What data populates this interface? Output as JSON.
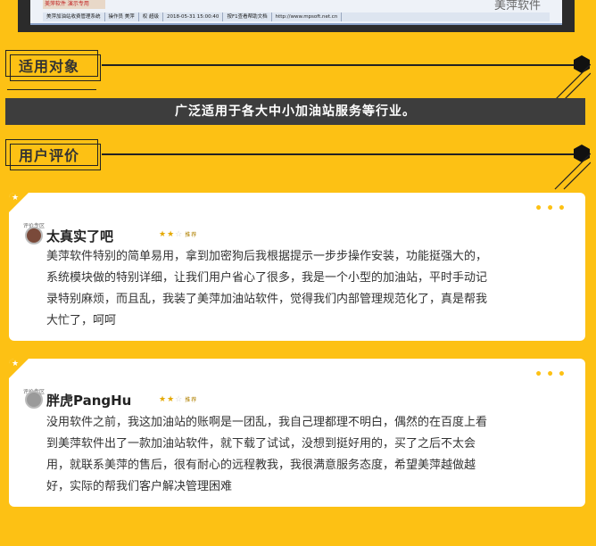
{
  "top_screenshot": {
    "banner_text": "美萍软件 演示专用",
    "status_items": [
      "美萍加油站收费管理系统",
      "操作员 美萍",
      "权 超级",
      "2018-05-31 15:00:40",
      "按F1查看帮助文档",
      "http://www.mpsoft.net.cn"
    ],
    "brand_text": "美萍软件"
  },
  "section_target": {
    "label": "适用对象"
  },
  "target_bar": {
    "text": "广泛适用于各大中小加油站服务等行业。"
  },
  "section_reviews": {
    "label": "用户评价"
  },
  "reviews": [
    {
      "tag": "评价专区",
      "name": "太真实了吧",
      "rating": 2.5,
      "rating_text": "推荐",
      "lines": [
        "美萍软件特别的简单易用，拿到加密狗后我根据提示一步步操作安装，功能挺强大的，",
        "系统模块做的特别详细，让我们用户省心了很多，我是一个小型的加油站，平时手动记",
        "录特别麻烦，而且乱，我装了美萍加油站软件，觉得我们内部管理规范化了，真是帮我",
        "大忙了，呵呵"
      ]
    },
    {
      "tag": "评价专区",
      "name": "胖虎PangHu",
      "rating": 2.5,
      "rating_text": "推荐",
      "lines": [
        "没用软件之前，我这加油站的账啊是一团乱，我自己理都理不明白，偶然的在百度上看",
        "到美萍软件出了一款加油站软件，就下载了试试，没想到挺好用的，买了之后不太会",
        "用，就联系美萍的售后，很有耐心的远程教我，我很满意服务态度，希望美萍越做越",
        "好，实际的帮我们客户解决管理困难"
      ]
    }
  ],
  "colors": {
    "background": "#FDC114",
    "dark_bar": "#3d3d3d",
    "card": "#ffffff"
  }
}
